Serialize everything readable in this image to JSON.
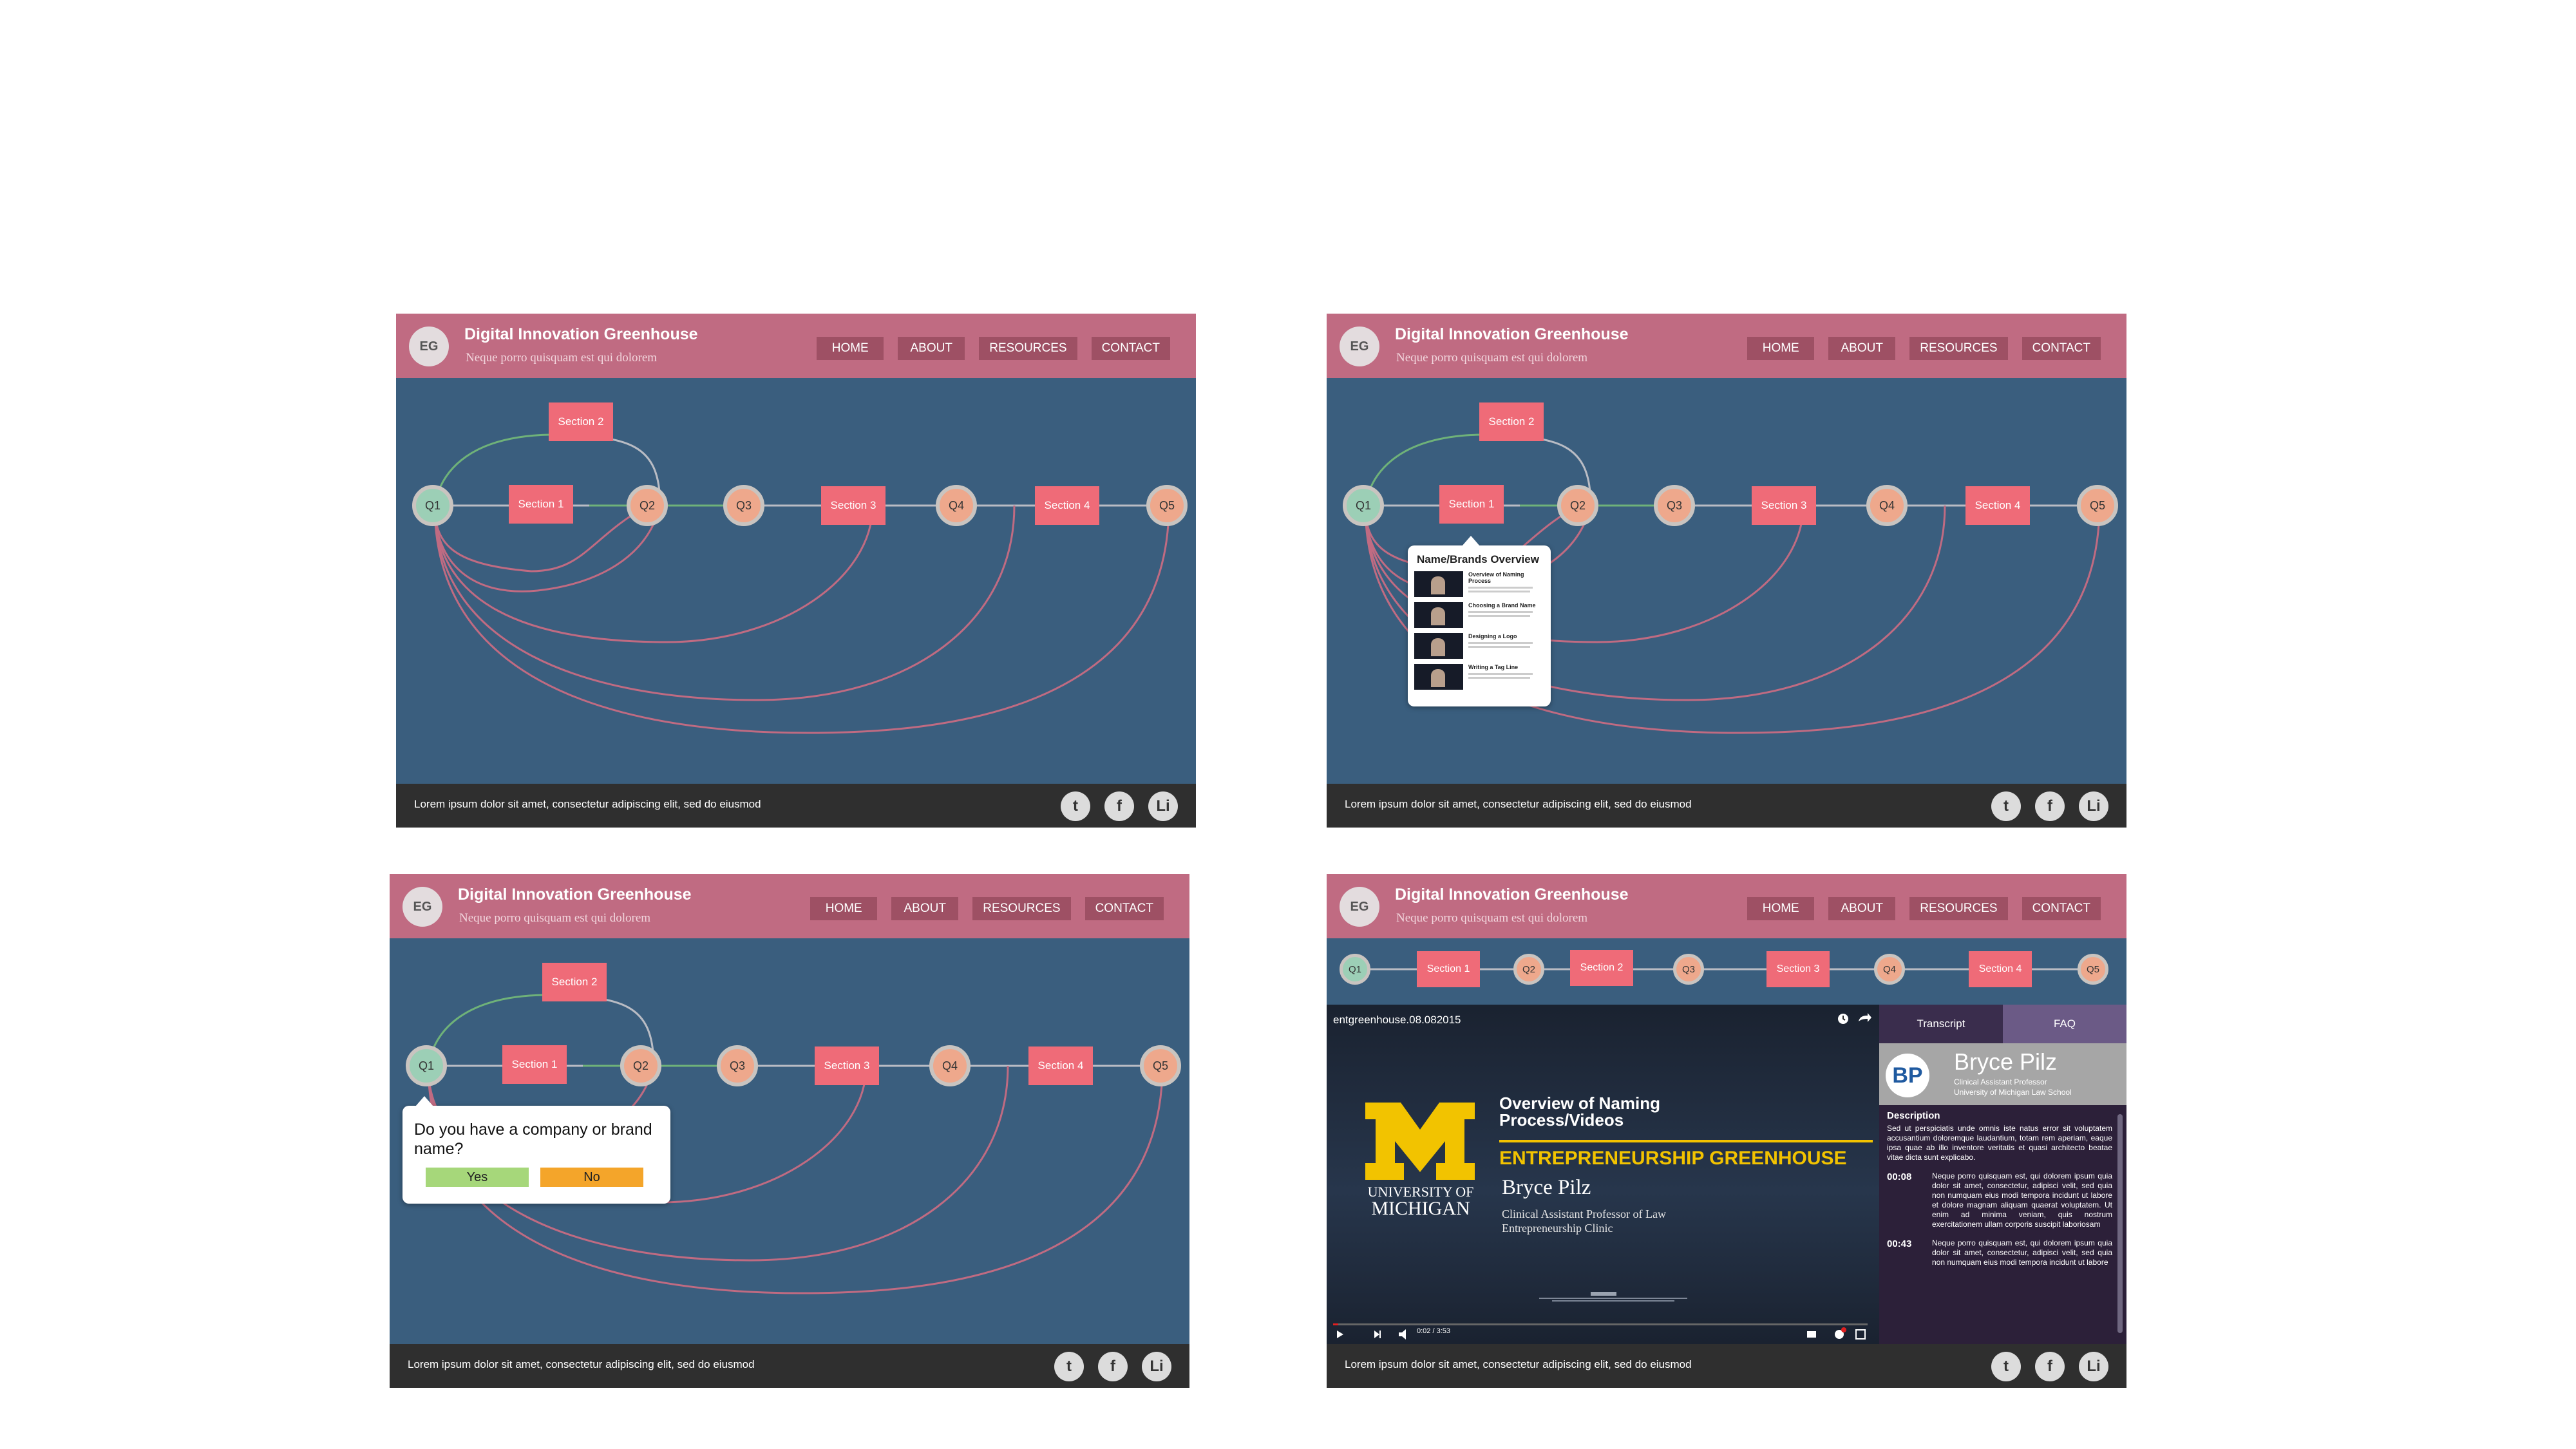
{
  "site": {
    "logo": "EG",
    "title": "Digital Innovation Greenhouse",
    "subtitle": "Neque porro quisquam est qui dolorem",
    "nav": [
      "HOME",
      "ABOUT",
      "RESOURCES",
      "CONTACT"
    ],
    "footer_text": "Lorem ipsum dolor sit amet, consectetur adipiscing elit, sed do eiusmod",
    "social": [
      "t",
      "f",
      "Li"
    ]
  },
  "flow": {
    "nodes": [
      "Q1",
      "Q2",
      "Q3",
      "Q4",
      "Q5"
    ],
    "sections": [
      "Section 1",
      "Section 2",
      "Section 3",
      "Section 4"
    ]
  },
  "section_popup": {
    "title": "Name/Brands Overview",
    "videos": [
      "Overview of Naming Process",
      "Choosing a Brand Name",
      "Designing a Logo",
      "Writing a Tag Line"
    ]
  },
  "question_popup": {
    "question": "Do you have a company or brand name?",
    "yes": "Yes",
    "no": "No",
    "yes_color": "#a6d77a",
    "no_color": "#f4a52a"
  },
  "video": {
    "file_title": "entgreenhouse.08.082015",
    "school_line1": "UNIVERSITY OF",
    "school_line2": "MICHIGAN",
    "topic": "Overview of Naming Process/Videos",
    "program": "ENTREPRENEURSHIP GREENHOUSE",
    "presenter": "Bryce Pilz",
    "presenter_role": "Clinical Assistant Professor of Law",
    "presenter_org": "Entrepreneurship Clinic",
    "time": "0:02 / 3:53"
  },
  "sidebar": {
    "tabs": [
      "Transcript",
      "FAQ"
    ],
    "initials": "BP",
    "name": "Bryce Pilz",
    "role": "Clinical Assistant Professor",
    "org": "University of Michigan Law School",
    "description_heading": "Description",
    "description": "Sed ut perspiciatis unde omnis iste natus error sit voluptatem accusantium doloremque laudantium, totam rem aperiam, eaque ipsa quae ab illo inventore veritatis et quasi architecto beatae vitae dicta sunt explicabo.",
    "transcript": [
      {
        "time": "00:08",
        "text": "Neque porro quisquam est, qui dolorem ipsum quia dolor sit amet, consectetur, adipisci velit, sed quia non numquam eius modi tempora incidunt ut labore et dolore magnam aliquam quaerat voluptatem. Ut enim ad minima veniam, quis nostrum exercitationem ullam corporis suscipit laboriosam"
      },
      {
        "time": "00:43",
        "text": "Neque porro quisquam est, qui dolorem ipsum quia dolor sit amet, consectetur, adipisci velit, sed quia non numquam eius modi tempora incidunt ut labore"
      }
    ]
  },
  "colors": {
    "header": "#c06b82",
    "nav_button": "#9e5064",
    "canvas": "#3a5e7e",
    "footer": "#2f2f2f",
    "section": "#ef6b78",
    "q1": "#9ccfb6",
    "q_other": "#eea88c",
    "sidebar": "#2c2039",
    "accent_yellow": "#f2c300"
  }
}
